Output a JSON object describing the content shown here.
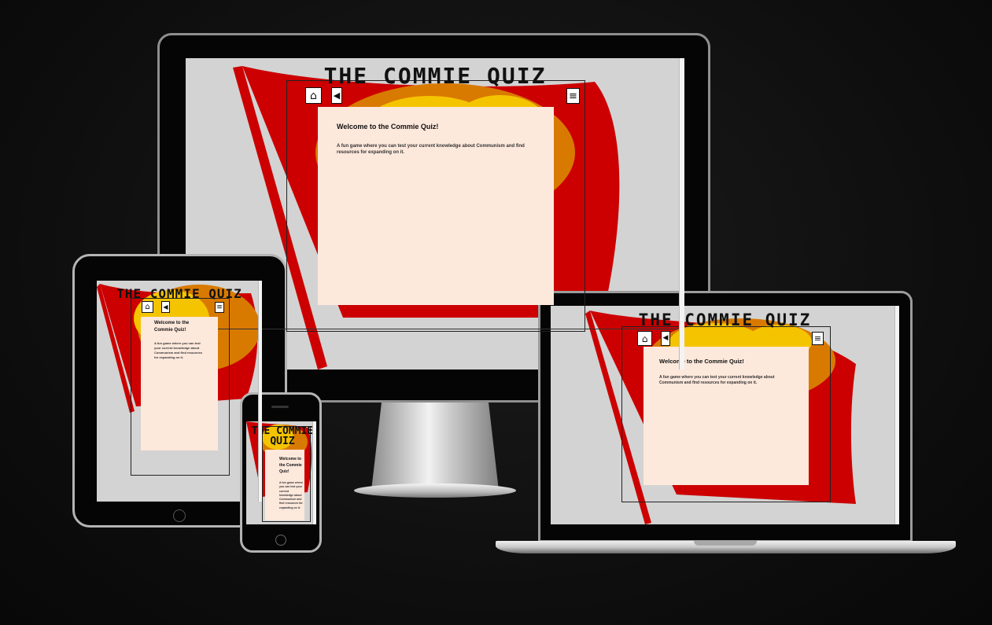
{
  "site": {
    "title": "THE COMMIE QUIZ",
    "welcome_heading": "Welcome to the Commie Quiz!",
    "welcome_text": "A fun game where you can test your current knowledge about Communism and find resources for expanding on it."
  },
  "nav": {
    "home_icon": "home-icon",
    "sound_icon": "speaker-icon",
    "menu_icon": "hamburger-menu-icon"
  },
  "colors": {
    "background": "#0d0d0d",
    "flag_red": "#cc0000",
    "emblem_orange": "#d97a00",
    "emblem_yellow": "#f5c400",
    "card_background": "#fde8dc",
    "screen_background": "#d3d3d3"
  },
  "devices": [
    "desktop",
    "tablet",
    "phone",
    "laptop"
  ]
}
